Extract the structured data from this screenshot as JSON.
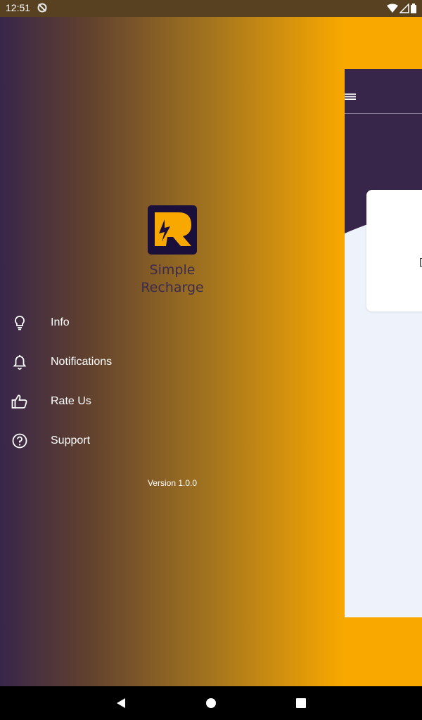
{
  "status_bar": {
    "time": "12:51",
    "icons": [
      "sync-off-icon",
      "wifi-icon",
      "signal-icon",
      "battery-icon"
    ]
  },
  "drawer": {
    "brand_line1": "Simple",
    "brand_line2": "Recharge",
    "items": [
      {
        "label": "Info",
        "icon": "lightbulb-icon"
      },
      {
        "label": "Notifications",
        "icon": "bell-icon"
      },
      {
        "label": "Rate Us",
        "icon": "thumb-up-icon"
      },
      {
        "label": "Support",
        "icon": "help-circle-icon"
      }
    ],
    "version": "Version 1.0.0"
  },
  "colors": {
    "purple": "#38264a",
    "orange": "#f9a800",
    "app_background": "#eef3fb"
  },
  "navigation_bar": {
    "buttons": [
      "back-icon",
      "home-icon",
      "recents-icon"
    ]
  }
}
